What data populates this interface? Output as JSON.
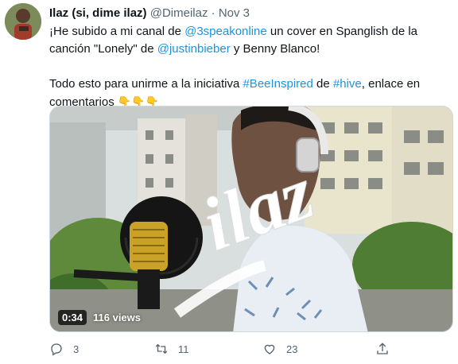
{
  "tweet": {
    "display_name": "Ilaz (si, dime ilaz)",
    "handle": "@Dimeilaz",
    "separator": "·",
    "date": "Nov 3",
    "line1_pre": "¡He subido a mi canal de ",
    "mention_1": "@3speakonline",
    "line1_post": "  un cover en Spanglish de la",
    "line2_pre": "canción \"Lonely\" de ",
    "mention_2": "@justinbieber",
    "line2_post": " y Benny Blanco!",
    "line3_pre": "Todo esto para unirme a la iniciativa ",
    "hashtag_1": "#BeeInspired",
    "line3_mid": " de ",
    "hashtag_2": "#hive",
    "line3_post": ", enlace en",
    "line4": "comentarios ",
    "emojis": "👇👇👇"
  },
  "video": {
    "duration": "0:34",
    "views": "116 views",
    "watermark": "ilaz"
  },
  "actions": {
    "replies": "3",
    "retweets": "11",
    "likes": "23"
  },
  "icons": [
    "reply-icon",
    "retweet-icon",
    "like-icon",
    "share-icon"
  ],
  "colors": {
    "link": "#1b95e0",
    "text": "#0f1419",
    "muted": "#536471"
  }
}
